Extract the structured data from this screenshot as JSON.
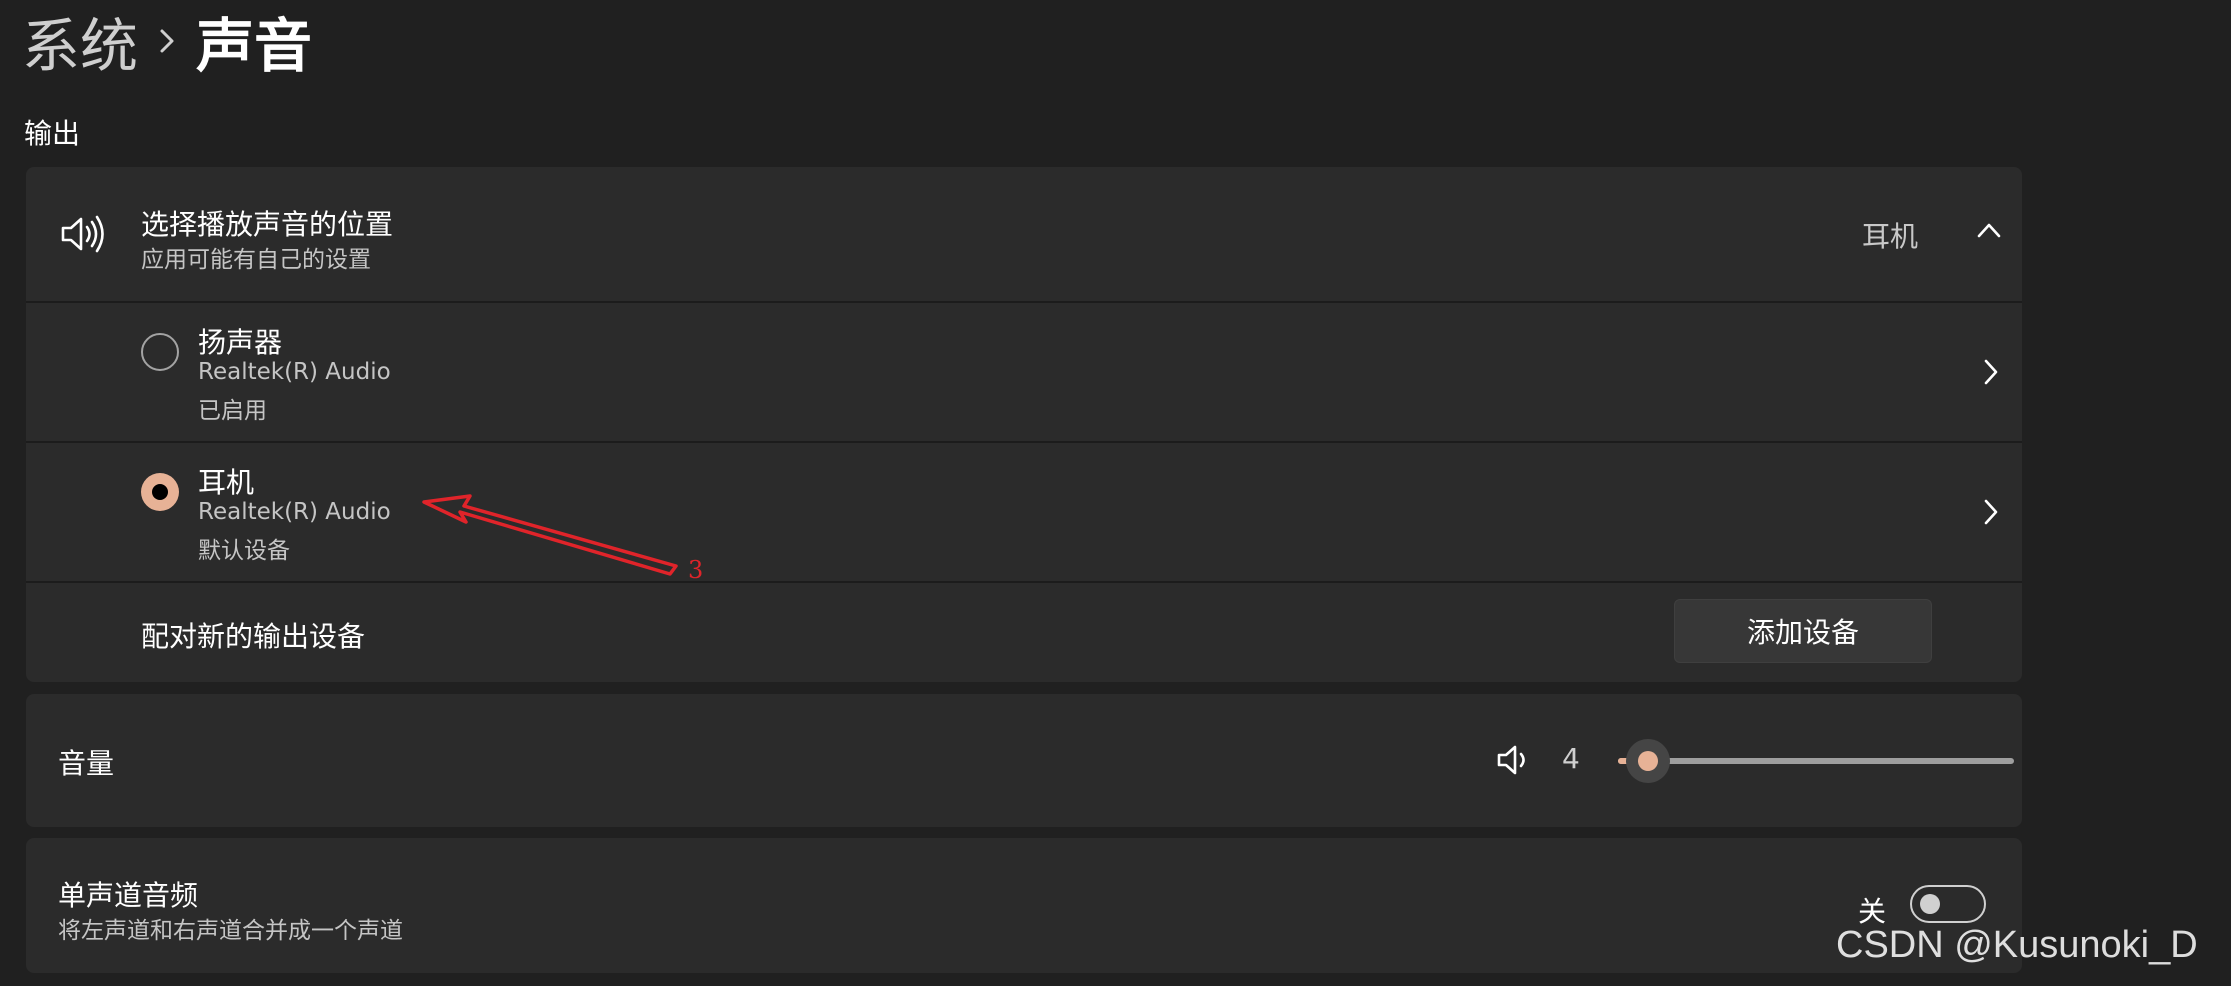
{
  "breadcrumb": {
    "parent": "系统",
    "current": "声音"
  },
  "output": {
    "section_title": "输出",
    "choose": {
      "title": "选择播放声音的位置",
      "subtitle": "应用可能有自己的设置",
      "selected_value": "耳机"
    },
    "devices": [
      {
        "name": "扬声器",
        "driver": "Realtek(R) Audio",
        "status": "已启用",
        "selected": false
      },
      {
        "name": "耳机",
        "driver": "Realtek(R) Audio",
        "status": "默认设备",
        "selected": true
      }
    ],
    "pair": {
      "label": "配对新的输出设备",
      "button": "添加设备"
    }
  },
  "volume": {
    "label": "音量",
    "value": "4",
    "level_percent": 4
  },
  "mono": {
    "title": "单声道音频",
    "subtitle": "将左声道和右声道合并成一个声道",
    "state_label": "关",
    "on": false
  },
  "annotation": {
    "number": "3"
  },
  "watermark": "CSDN @Kusunoki_D",
  "colors": {
    "accent": "#e7b296",
    "background": "#202020",
    "card": "#2b2b2b",
    "annotation": "#e0242a"
  }
}
